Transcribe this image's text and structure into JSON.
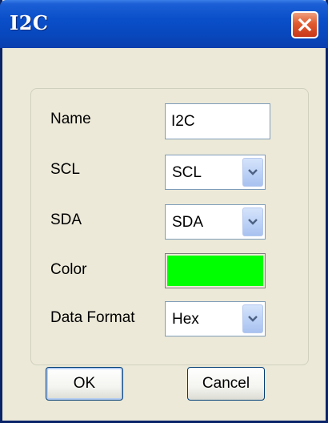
{
  "window": {
    "title": "I2C",
    "close_icon": "close-icon",
    "colors": {
      "titlebar": "#0a4fc9",
      "close": "#e05a2e",
      "body": "#ece9d8"
    }
  },
  "form": {
    "name": {
      "label": "Name",
      "value": "I2C"
    },
    "scl": {
      "label": "SCL",
      "selected": "SCL"
    },
    "sda": {
      "label": "SDA",
      "selected": "SDA"
    },
    "color": {
      "label": "Color",
      "value": "#00ff00"
    },
    "data_format": {
      "label": "Data Format",
      "selected": "Hex"
    }
  },
  "buttons": {
    "ok": "OK",
    "cancel": "Cancel"
  }
}
